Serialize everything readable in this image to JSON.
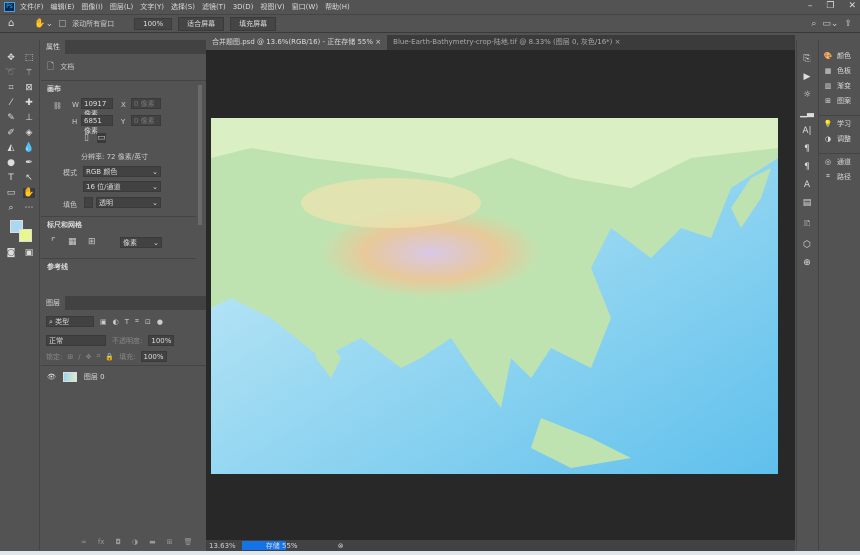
{
  "app": {
    "logo": "Ps"
  },
  "menu": [
    "文件(F)",
    "编辑(E)",
    "图像(I)",
    "图层(L)",
    "文字(Y)",
    "选择(S)",
    "滤镜(T)",
    "3D(D)",
    "视图(V)",
    "窗口(W)",
    "帮助(H)"
  ],
  "options": {
    "scroll_all": "滚动所有窗口",
    "zoom": "100%",
    "fit_screen": "适合屏幕",
    "fill_screen": "填充屏幕"
  },
  "tabs": [
    {
      "label": "合并题图.psd @ 13.6%(RGB/16) - 正在存储 55%",
      "close": "×"
    },
    {
      "label": "Blue-Earth-Bathymetry-crop-陆地.tif @ 8.33% (图层 0, 灰色/16*)",
      "close": "×"
    }
  ],
  "properties": {
    "title": "属性",
    "doc_label": "文档",
    "canvas_section": "画布",
    "w_label": "W",
    "w_value": "10917 像素",
    "h_label": "H",
    "h_value": "6851 像素",
    "x_label": "X",
    "x_value": "0 像素",
    "y_label": "Y",
    "y_value": "0 像素",
    "resolution": "分辨率: 72 像素/英寸",
    "mode_label": "模式",
    "mode_value": "RGB 颜色",
    "depth_value": "16 位/通道",
    "fill_label": "填色",
    "fill_value": "透明",
    "rulers_section": "标尺和网格",
    "units_value": "像素",
    "guides_section": "参考线"
  },
  "layers": {
    "title": "图层",
    "filter": "类型",
    "blend": "正常",
    "opacity_label": "不透明度:",
    "opacity_value": "100%",
    "lock_label": "锁定:",
    "fill_label": "填充:",
    "fill_value": "100%",
    "items": [
      {
        "name": "图层 0"
      }
    ]
  },
  "status": {
    "zoom": "13.63%",
    "progress_label": "存储 55%",
    "progress": 55
  },
  "right_panel": [
    "颜色",
    "色板",
    "渐变",
    "图案",
    "学习",
    "调整",
    "通道",
    "路径"
  ]
}
